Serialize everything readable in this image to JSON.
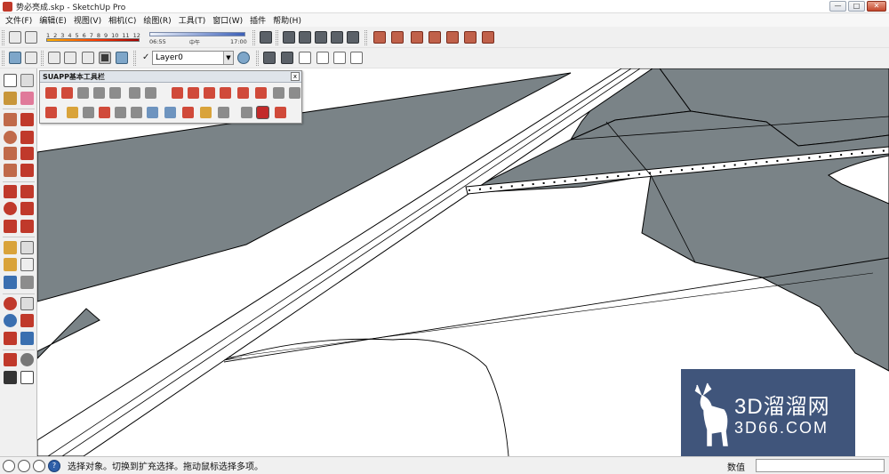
{
  "window": {
    "title": "势必亮成.skp - SketchUp Pro",
    "controls": {
      "minimize": "—",
      "maximize": "□",
      "close": "✕"
    }
  },
  "menu": [
    "文件(F)",
    "编辑(E)",
    "视图(V)",
    "相机(C)",
    "绘图(R)",
    "工具(T)",
    "窗口(W)",
    "插件",
    "帮助(H)"
  ],
  "shadow_settings": {
    "month_scale": [
      "1",
      "2",
      "3",
      "4",
      "5",
      "6",
      "7",
      "8",
      "9",
      "10",
      "11",
      "12"
    ],
    "time_start": "06:55",
    "time_noon": "中午",
    "time_end": "17:00"
  },
  "layer": {
    "check": "✓",
    "current": "Layer0",
    "caret": "▼"
  },
  "suapp_panel": {
    "title": "SUAPP基本工具栏",
    "close": "x"
  },
  "watermark": {
    "brand": "3D溜溜网",
    "domain": "3D66.COM",
    "color": "#304670"
  },
  "status": {
    "message": "选择对象。切换到扩充选择。拖动鼠标选择多项。",
    "value_label": "数值",
    "value": "",
    "help": "?"
  },
  "colors": {
    "surface_gray": "#7a8387",
    "edge": "#000000",
    "background": "#ffffff"
  }
}
